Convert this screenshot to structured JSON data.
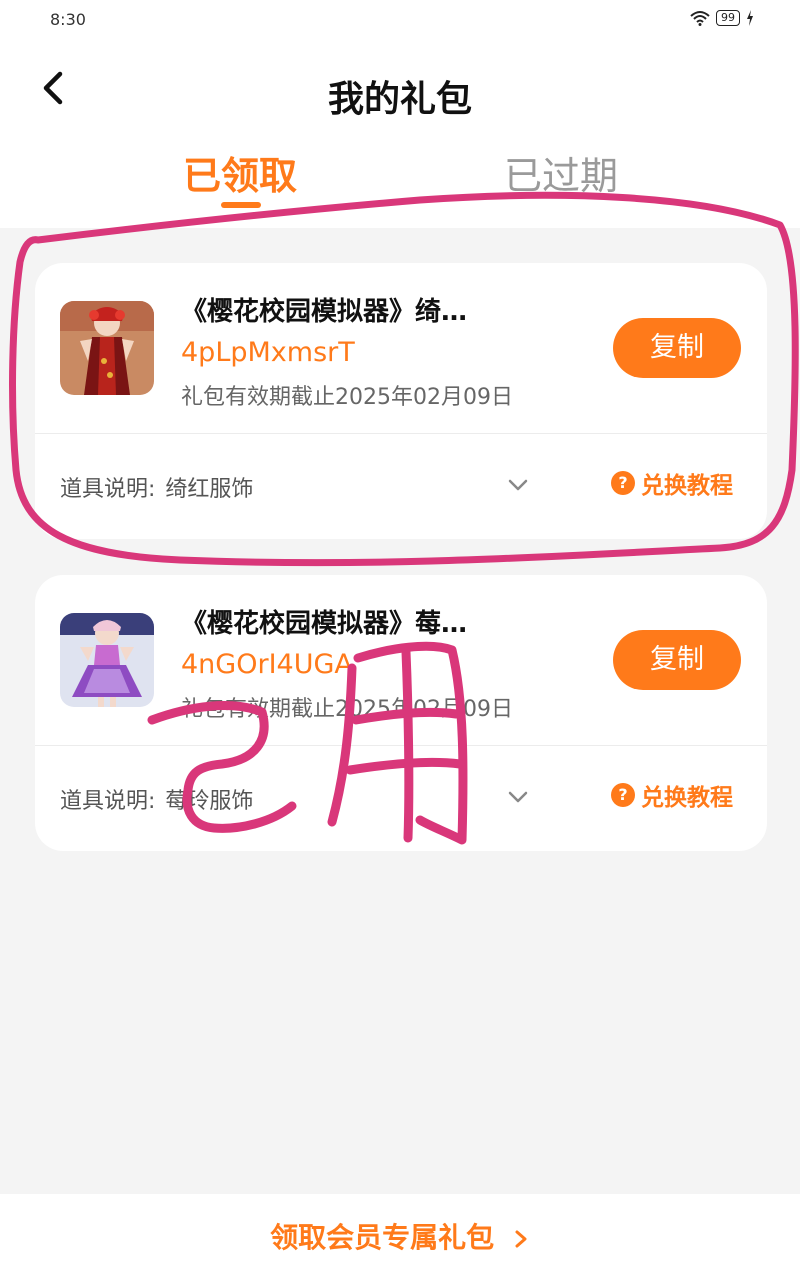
{
  "status": {
    "time": "8:30",
    "battery": "99"
  },
  "header": {
    "title": "我的礼包"
  },
  "tabs": [
    {
      "label": "已领取",
      "active": true
    },
    {
      "label": "已过期",
      "active": false
    }
  ],
  "gifts": [
    {
      "name": "《樱花校园模拟器》绮…",
      "code": "4pLpMxmsrT",
      "expire": "礼包有效期截止2025年02月09日",
      "copy_label": "复制",
      "desc_label": "道具说明:",
      "desc_value": "绮红服饰",
      "tutorial_label": "兑换教程"
    },
    {
      "name": "《樱花校园模拟器》莓…",
      "code": "4nGOrI4UGA",
      "expire": "礼包有效期截止2025年02月09日",
      "copy_label": "复制",
      "desc_label": "道具说明:",
      "desc_value": "莓玲服饰",
      "tutorial_label": "兑换教程"
    }
  ],
  "footer": {
    "vip_link": "领取会员专属礼包"
  },
  "colors": {
    "accent": "#ff7a1a",
    "annotation": "#d9377a"
  }
}
